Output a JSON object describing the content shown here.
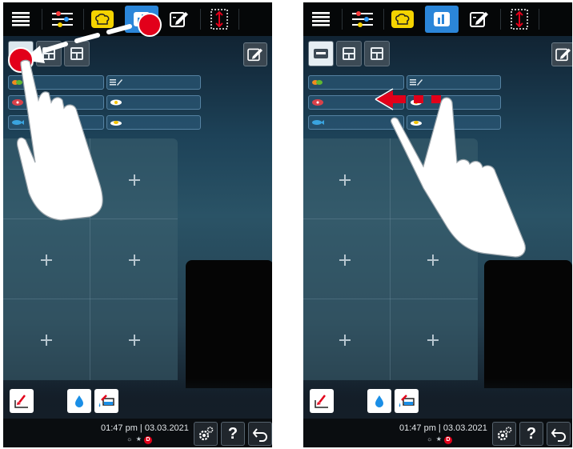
{
  "screens": [
    {
      "status": {
        "time": "01:47 pm",
        "date": "03.03.2021",
        "badge": "D"
      },
      "active_tab": "program-tab"
    },
    {
      "status": {
        "time": "01:47 pm",
        "date": "03.03.2021",
        "badge": "D"
      },
      "active_tab": "program-tab"
    }
  ],
  "toolbar_icons": [
    "menu-icon",
    "settings-sliders-icon",
    "chef-hat-icon",
    "program-icon",
    "edit-icon",
    "scroll-icon"
  ],
  "category_icons": [
    "vegetable-icon",
    "meat-icon",
    "fish-icon",
    "edit-list-icon",
    "egg-icon",
    "side-dish-icon"
  ],
  "bottom_icons": [
    "cleaning-icon",
    "water-drop-icon",
    "descale-icon",
    "gear-icon",
    "help-icon",
    "back-icon"
  ],
  "help_label": "?",
  "colors": {
    "accent": "#2b86d9",
    "chef": "#f5d400",
    "marker": "#e2001a",
    "panel": "#1d4258"
  }
}
